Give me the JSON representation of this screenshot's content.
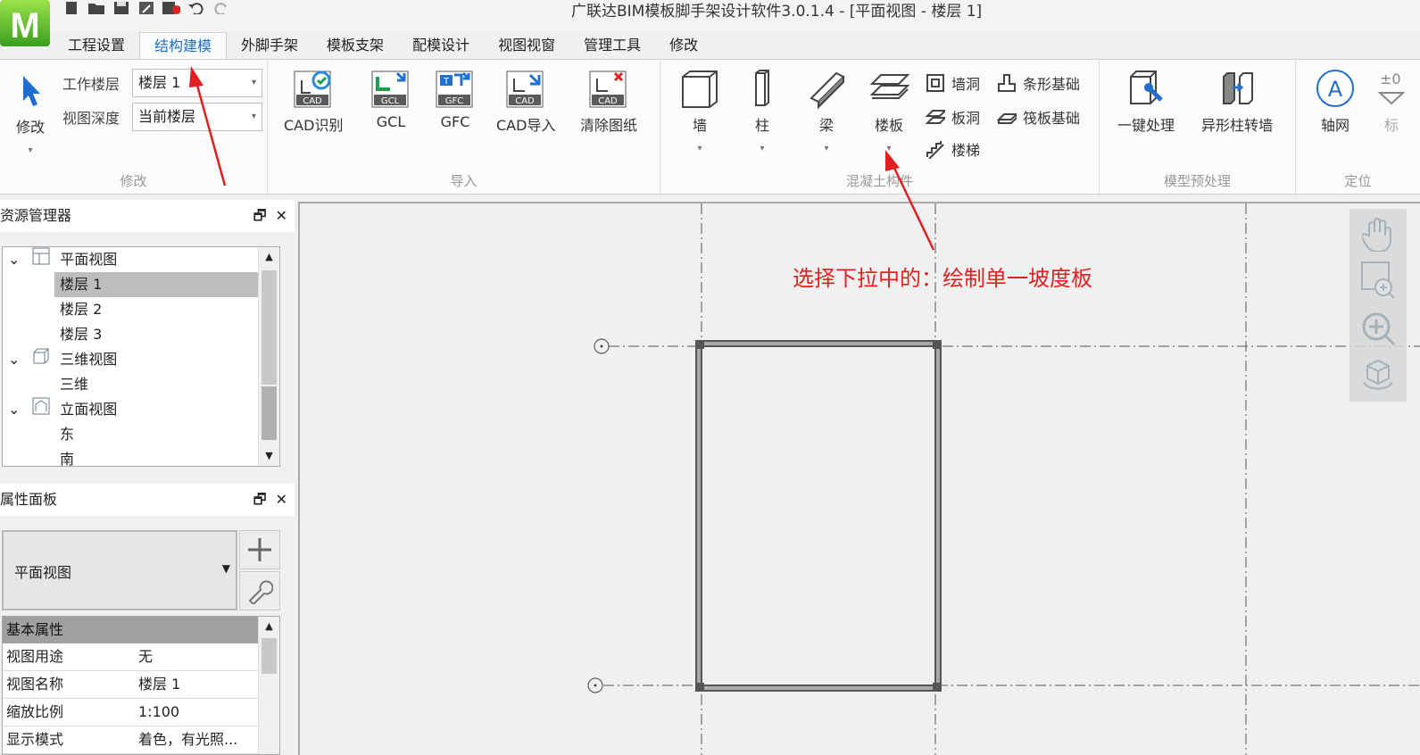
{
  "app": {
    "title": "广联达BIM模板脚手架设计软件3.0.1.4 - [平面视图 - 楼层 1]",
    "logo_letter": "M"
  },
  "menu": {
    "tabs": [
      "工程设置",
      "结构建模",
      "外脚手架",
      "模板支架",
      "配模设计",
      "视图视窗",
      "管理工具",
      "修改"
    ],
    "active_index": 1
  },
  "ribbon": {
    "modify_group": {
      "label": "修改",
      "modify_button": "修改",
      "work_floor_label": "工作楼层",
      "work_floor_value": "楼层 1",
      "view_depth_label": "视图深度",
      "view_depth_value": "当前楼层"
    },
    "import_group": {
      "label": "导入",
      "buttons": [
        "CAD识别",
        "GCL",
        "GFC",
        "CAD导入",
        "清除图纸"
      ],
      "badges": [
        "CAD",
        "GCL",
        "GFC",
        "CAD",
        "CAD"
      ]
    },
    "concrete_group": {
      "label": "混凝土构件",
      "big_buttons": [
        "墙",
        "柱",
        "梁",
        "楼板"
      ],
      "small_buttons": [
        "墙洞",
        "板洞",
        "楼梯",
        "条形基础",
        "筏板基础"
      ]
    },
    "preprocess_group": {
      "label": "模型预处理",
      "buttons": [
        "一键处理",
        "异形柱转墙"
      ]
    },
    "locate_group": {
      "label": "定位",
      "buttons": [
        "轴网",
        "标"
      ]
    }
  },
  "resource_panel": {
    "title": "资源管理器",
    "tree": [
      {
        "label": "平面视图",
        "level": 0,
        "expanded": true
      },
      {
        "label": "楼层 1",
        "level": 1,
        "selected": true
      },
      {
        "label": "楼层 2",
        "level": 1
      },
      {
        "label": "楼层 3",
        "level": 1
      },
      {
        "label": "三维视图",
        "level": 0,
        "expanded": true
      },
      {
        "label": "三维",
        "level": 1
      },
      {
        "label": "立面视图",
        "level": 0,
        "expanded": true
      },
      {
        "label": "东",
        "level": 1
      },
      {
        "label": "南",
        "level": 1
      }
    ]
  },
  "property_panel": {
    "title": "属性面板",
    "type_value": "平面视图",
    "section_header": "基本属性",
    "rows": [
      {
        "key": "视图用途",
        "value": "无"
      },
      {
        "key": "视图名称",
        "value": "楼层 1"
      },
      {
        "key": "缩放比例",
        "value": "1:100"
      },
      {
        "key": "显示模式",
        "value": "着色，有光照..."
      }
    ]
  },
  "annotation": {
    "text": "选择下拉中的：绘制单一坡度板",
    "color": "#e02020"
  },
  "colors": {
    "accent": "#1a6fc4",
    "annotation_red": "#e02020",
    "wall_gray": "#8a8a8a"
  }
}
